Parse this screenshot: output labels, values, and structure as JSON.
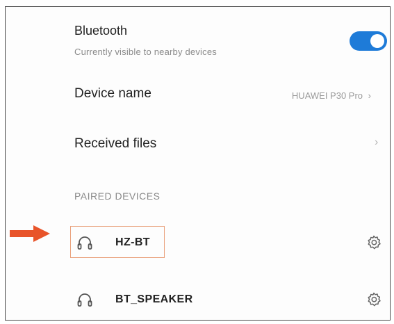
{
  "bluetooth": {
    "title": "Bluetooth",
    "subtitle": "Currently visible to nearby devices",
    "toggle_on": true,
    "accent_color": "#1e7bd8"
  },
  "device_name": {
    "label": "Device name",
    "value": "HUAWEI P30 Pro",
    "chevron": "›"
  },
  "received_files": {
    "label": "Received files",
    "chevron": "›"
  },
  "paired_section": {
    "header": "PAIRED DEVICES",
    "devices": [
      {
        "name": "HZ-BT",
        "icon": "headphones-icon",
        "settings_icon": "gear-icon",
        "highlighted": true
      },
      {
        "name": "BT_SPEAKER",
        "icon": "headphones-icon",
        "settings_icon": "gear-icon",
        "highlighted": false
      }
    ]
  },
  "annotation": {
    "arrow_color": "#e8542a",
    "box_color": "#e9a07a"
  }
}
